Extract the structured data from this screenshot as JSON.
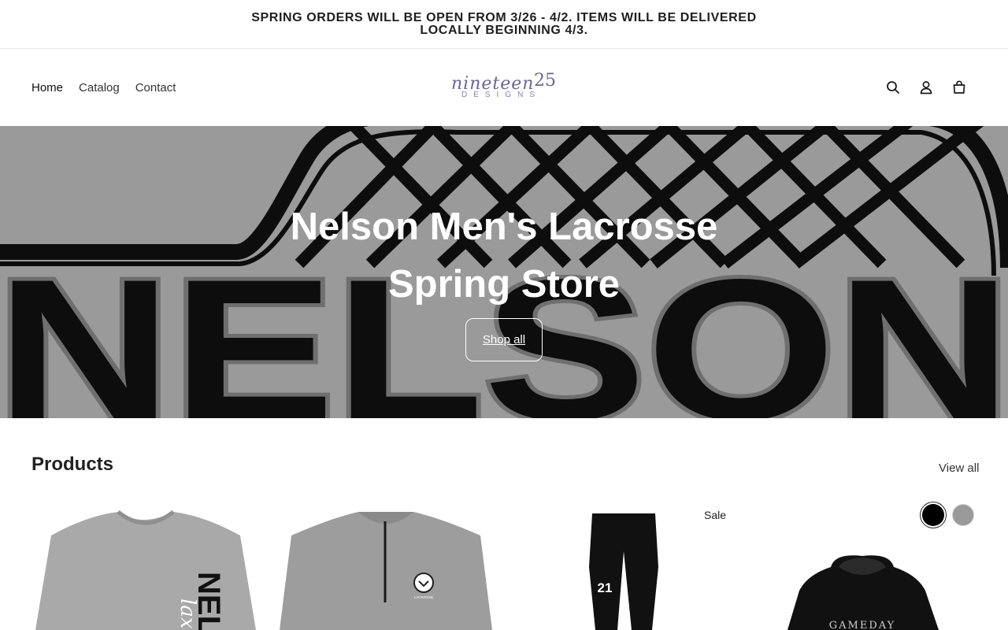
{
  "announcement": {
    "text": "SPRING ORDERS WILL BE OPEN FROM 3/26 - 4/2. ITEMS WILL BE DELIVERED LOCALLY BEGINNING 4/3."
  },
  "nav": {
    "items": [
      {
        "label": "Home"
      },
      {
        "label": "Catalog"
      },
      {
        "label": "Contact"
      }
    ]
  },
  "logo": {
    "text_main": "nineteen",
    "text_number": "25",
    "text_sub": "DESIGNS",
    "color": "#6e6497"
  },
  "header_icons": [
    "search-icon",
    "account-icon",
    "cart-icon"
  ],
  "hero": {
    "title_line1": "Nelson Men's Lacrosse",
    "title_line2": "Spring Store",
    "button_label": "Shop all",
    "background_text": "NELSON",
    "background_color": "#9a9a9a"
  },
  "products": {
    "heading": "Products",
    "view_all": "View all",
    "items": [
      {
        "name": "grey crewneck sweatshirt",
        "print_text": "NEL",
        "script_text": "lax"
      },
      {
        "name": "grey quarter-zip pullover",
        "print_text": "LACROSSE"
      },
      {
        "name": "black sweatpants",
        "print_text": "21",
        "badge": "Sale"
      },
      {
        "name": "black hoodie",
        "print_text": "GAMEDAY"
      }
    ],
    "swatches": [
      {
        "name": "Black",
        "color": "#000000"
      },
      {
        "name": "Grey",
        "color": "#9a9a9a"
      }
    ]
  }
}
